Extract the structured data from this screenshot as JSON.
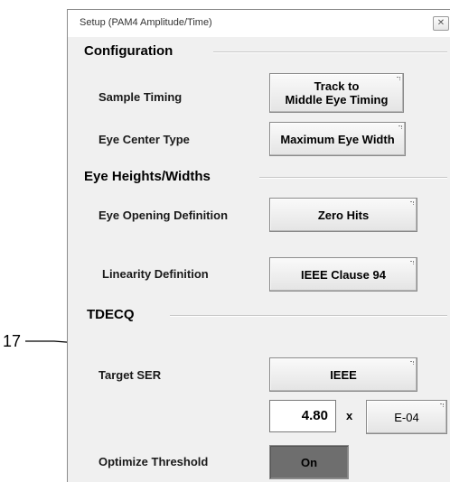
{
  "window": {
    "title": "Setup (PAM4 Amplitude/Time)",
    "close_glyph": "✕"
  },
  "sections": {
    "configuration": "Configuration",
    "eye_heights_widths": "Eye Heights/Widths",
    "tdecq": "TDECQ"
  },
  "rows": {
    "sample_timing": {
      "label": "Sample Timing",
      "value_line1": "Track to",
      "value_line2": "Middle Eye Timing"
    },
    "eye_center_type": {
      "label": "Eye Center Type",
      "value": "Maximum Eye Width"
    },
    "eye_opening_definition": {
      "label": "Eye Opening Definition",
      "value": "Zero Hits"
    },
    "linearity_definition": {
      "label": "Linearity Definition",
      "value": "IEEE Clause 94"
    },
    "target_ser": {
      "label": "Target SER",
      "value": "IEEE",
      "mantissa": "4.80",
      "multiplier": "x",
      "exponent": "E-04"
    },
    "optimize_threshold": {
      "label": "Optimize Threshold",
      "value": "On"
    }
  },
  "callout": {
    "number": "17"
  },
  "colors": {
    "dialog_bg": "#f0f0f0",
    "toggle_on_bg": "#6e6e6e"
  }
}
